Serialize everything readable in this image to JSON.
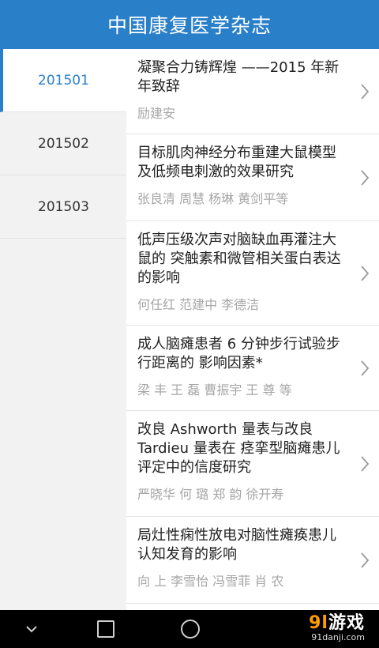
{
  "header": {
    "title": "中国康复医学杂志"
  },
  "sidebar": {
    "items": [
      {
        "label": "201501",
        "selected": true
      },
      {
        "label": "201502",
        "selected": false
      },
      {
        "label": "201503",
        "selected": false
      }
    ]
  },
  "articles": [
    {
      "title": "凝聚合力铸辉煌 ——2015 年新年致辞",
      "authors": "励建安"
    },
    {
      "title": "目标肌肉神经分布重建大鼠模型及低频电刺激的效果研究",
      "authors": "张良清 周慧 杨琳 黄剑平等"
    },
    {
      "title": "低声压级次声对脑缺血再灌注大鼠的 突触素和微管相关蛋白表达的影响",
      "authors": "何任红  范建中 李德洁"
    },
    {
      "title": "成人脑瘫患者 6 分钟步行试验步行距离的 影响因素*",
      "authors": "梁 丰 王 磊 曹振宇 王 尊 等"
    },
    {
      "title": "改良 Ashworth 量表与改良 Tardieu 量表在 痉挛型脑瘫患儿评定中的信度研究",
      "authors": "严晓华 何 璐 郑 韵 徐开寿"
    },
    {
      "title": "局灶性痫性放电对脑性瘫痪患儿认知发育的影响",
      "authors": "向 上 李雪怡 冯雪菲 肖 农"
    }
  ],
  "watermark": {
    "logo_number": "9l",
    "logo_text": "游戏",
    "url": "91danji.com"
  },
  "colors": {
    "accent": "#2a7fc9",
    "header_bg": "#2a7fc9",
    "sidebar_bg": "#f2f2f2"
  }
}
